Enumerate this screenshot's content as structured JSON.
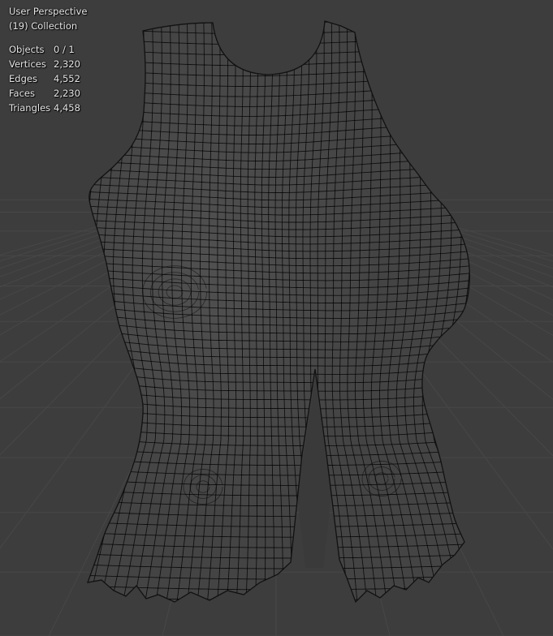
{
  "viewport": {
    "view_name": "User Perspective",
    "collection": "(19) Collection",
    "background_color": "#3d3d3d",
    "grid_color": "#474747",
    "wire_color": "#000000",
    "surface_color": "#464646"
  },
  "statistics": [
    {
      "label": "Objects",
      "value": "0 / 1"
    },
    {
      "label": "Vertices",
      "value": "2,320"
    },
    {
      "label": "Edges",
      "value": "4,552"
    },
    {
      "label": "Faces",
      "value": "2,230"
    },
    {
      "label": "Triangles",
      "value": "4,458"
    }
  ]
}
